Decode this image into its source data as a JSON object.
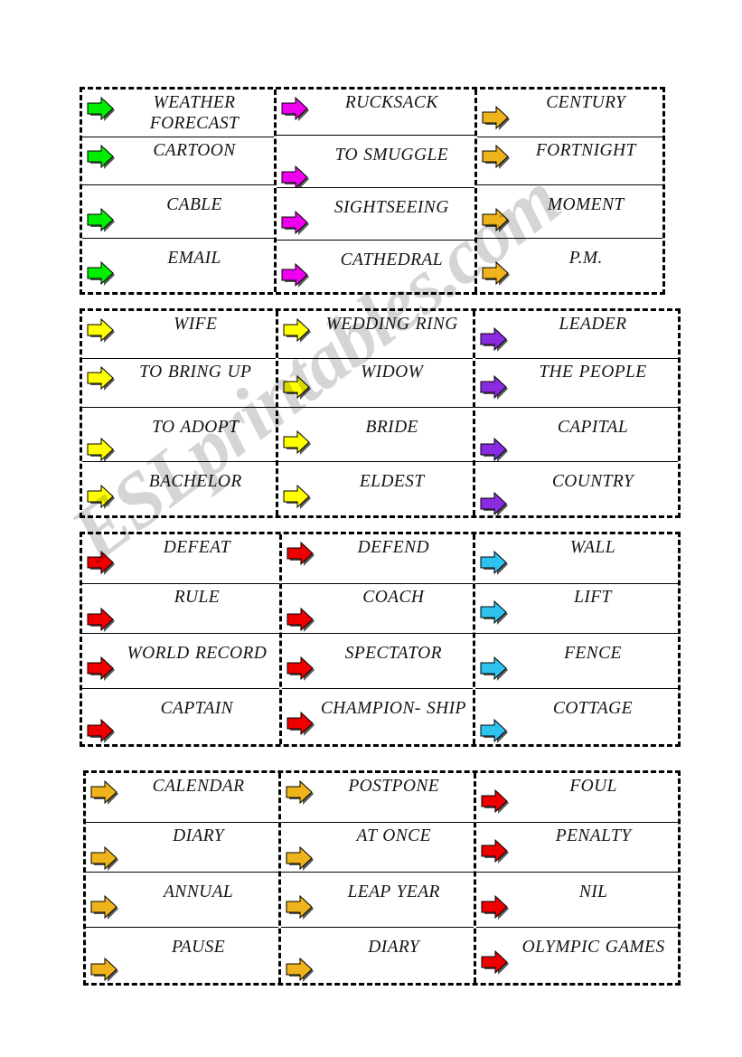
{
  "page": {
    "kind": "vocabulary-domino-cards-worksheet",
    "watermark": "ESLprintables.com",
    "background_color": "#ffffff",
    "border_style": "dashed",
    "border_color": "#000000",
    "row_line_color": "#000000"
  },
  "palette": {
    "green": "#00EE00",
    "magenta": "#EE00EE",
    "amber": "#EFB31C",
    "yellow": "#FFFF00",
    "purple": "#8A2BE2",
    "red": "#EE0000",
    "cyan": "#2EC3EE"
  },
  "sections": [
    {
      "id": "section-1",
      "columns": [
        {
          "id": "s1-col-1",
          "arrow_color_name": "green",
          "arrow_color": "#00EE00",
          "cells": [
            {
              "term": "WEATHER FORECAST"
            },
            {
              "term": "CARTOON"
            },
            {
              "term": "CABLE"
            },
            {
              "term": "EMAIL"
            }
          ]
        },
        {
          "id": "s1-col-2",
          "arrow_color_name": "magenta",
          "arrow_color": "#EE00EE",
          "cells": [
            {
              "term": "RUCKSACK"
            },
            {
              "term": "TO SMUGGLE"
            },
            {
              "term": "SIGHTSEEING"
            },
            {
              "term": "CATHEDRAL"
            }
          ]
        },
        {
          "id": "s1-col-3",
          "arrow_color_name": "amber",
          "arrow_color": "#EFB31C",
          "cells": [
            {
              "term": "CENTURY"
            },
            {
              "term": "FORTNIGHT"
            },
            {
              "term": "MOMENT"
            },
            {
              "term": "P.M."
            }
          ]
        }
      ]
    },
    {
      "id": "section-2",
      "columns": [
        {
          "id": "s2-col-1",
          "arrow_color_name": "yellow",
          "arrow_color": "#FFFF00",
          "cells": [
            {
              "term": "WIFE"
            },
            {
              "term": "TO BRING UP"
            },
            {
              "term": "TO ADOPT"
            },
            {
              "term": "BACHELOR"
            }
          ]
        },
        {
          "id": "s2-col-2",
          "arrow_color_name": "yellow",
          "arrow_color": "#FFFF00",
          "cells": [
            {
              "term": "WEDDING RING"
            },
            {
              "term": "WIDOW"
            },
            {
              "term": "BRIDE"
            },
            {
              "term": "ELDEST"
            }
          ]
        },
        {
          "id": "s2-col-3",
          "arrow_color_name": "purple",
          "arrow_color": "#8A2BE2",
          "cells": [
            {
              "term": "LEADER"
            },
            {
              "term": "THE PEOPLE"
            },
            {
              "term": "CAPITAL"
            },
            {
              "term": "COUNTRY"
            }
          ]
        }
      ]
    },
    {
      "id": "section-3",
      "columns": [
        {
          "id": "s3-col-1",
          "arrow_color_name": "red",
          "arrow_color": "#EE0000",
          "cells": [
            {
              "term": "DEFEAT"
            },
            {
              "term": "RULE"
            },
            {
              "term": "WORLD RECORD"
            },
            {
              "term": "CAPTAIN"
            }
          ]
        },
        {
          "id": "s3-col-2",
          "arrow_color_name": "red",
          "arrow_color": "#EE0000",
          "cells": [
            {
              "term": "DEFEND"
            },
            {
              "term": "COACH"
            },
            {
              "term": "SPECTATOR"
            },
            {
              "term": "CHAMPION- SHIP"
            }
          ]
        },
        {
          "id": "s3-col-3",
          "arrow_color_name": "cyan",
          "arrow_color": "#2EC3EE",
          "cells": [
            {
              "term": "WALL"
            },
            {
              "term": "LIFT"
            },
            {
              "term": "FENCE"
            },
            {
              "term": "COTTAGE"
            }
          ]
        }
      ]
    },
    {
      "id": "section-4",
      "columns": [
        {
          "id": "s4-col-1",
          "arrow_color_name": "amber",
          "arrow_color": "#EFB31C",
          "cells": [
            {
              "term": "CALENDAR"
            },
            {
              "term": "DIARY"
            },
            {
              "term": "ANNUAL"
            },
            {
              "term": "PAUSE"
            }
          ]
        },
        {
          "id": "s4-col-2",
          "arrow_color_name": "amber",
          "arrow_color": "#EFB31C",
          "cells": [
            {
              "term": "POSTPONE"
            },
            {
              "term": "AT ONCE"
            },
            {
              "term": "LEAP YEAR"
            },
            {
              "term": "DIARY"
            }
          ]
        },
        {
          "id": "s4-col-3",
          "arrow_color_name": "red",
          "arrow_color": "#EE0000",
          "cells": [
            {
              "term": "FOUL"
            },
            {
              "term": "PENALTY"
            },
            {
              "term": "NIL"
            },
            {
              "term": "OLYMPIC GAMES"
            }
          ]
        }
      ]
    }
  ]
}
